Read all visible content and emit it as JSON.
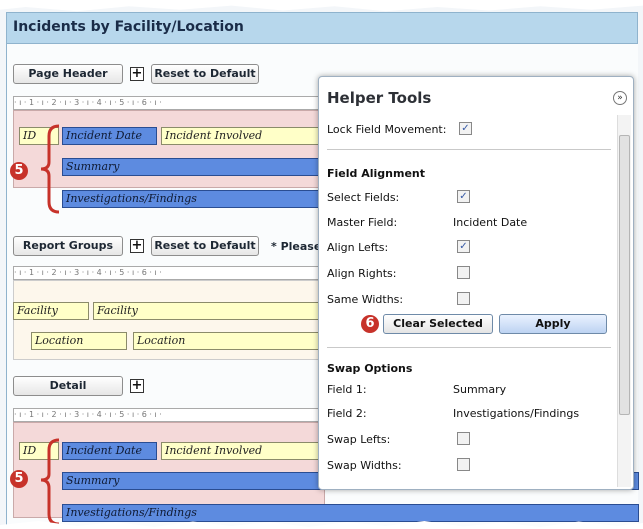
{
  "title": "Incidents by Facility/Location",
  "page_header": {
    "button": "Page Header",
    "reset": "Reset to Default"
  },
  "ruler_text": "· ı · 1 · ı · 2 · ı · 3 · ı · 4 · ı · 5 · ı · 6 · ı ·",
  "header_fields": {
    "id": "ID",
    "incident_date": "Incident Date",
    "incident_involved": "Incident Involved",
    "summary": "Summary",
    "investigations": "Investigations/Findings"
  },
  "report_groups": {
    "button": "Report Groups",
    "reset": "Reset to Default",
    "note": "* Please"
  },
  "group_fields": {
    "facility_label": "Facility",
    "facility_value": "Facility",
    "location_label": "Location",
    "location_value": "Location"
  },
  "detail": {
    "button": "Detail"
  },
  "detail_fields": {
    "id": "ID",
    "incident_date": "Incident Date",
    "incident_involved": "Incident Involved",
    "summary": "Summary",
    "investigations": "Investigations/Findings"
  },
  "badges": {
    "five": "5",
    "six": "6"
  },
  "plus_glyph": "+",
  "helper": {
    "title": "Helper Tools",
    "collapse_glyph": "»",
    "lock_label": "Lock Field Movement:",
    "field_alignment": "Field Alignment",
    "select_fields": "Select Fields:",
    "master_field": "Master Field:",
    "master_value": "Incident Date",
    "align_lefts": "Align Lefts:",
    "align_rights": "Align Rights:",
    "same_widths": "Same Widths:",
    "clear_selected": "Clear Selected",
    "apply": "Apply",
    "swap_options": "Swap Options",
    "field1": "Field 1:",
    "field1_value": "Summary",
    "field2": "Field 2:",
    "field2_value": "Investigations/Findings",
    "swap_lefts": "Swap Lefts:",
    "swap_widths": "Swap Widths:",
    "checked": {
      "lock": true,
      "select_fields": true,
      "align_lefts": true,
      "align_rights": false,
      "same_widths": false,
      "swap_lefts": false,
      "swap_widths": false
    }
  },
  "colors": {
    "title_bar": "#b7d7ec",
    "field_blue": "#5d8be0",
    "field_yellow": "#ffffc8",
    "badge_red": "#c7322a",
    "band_pink": "#f4d9d9"
  }
}
